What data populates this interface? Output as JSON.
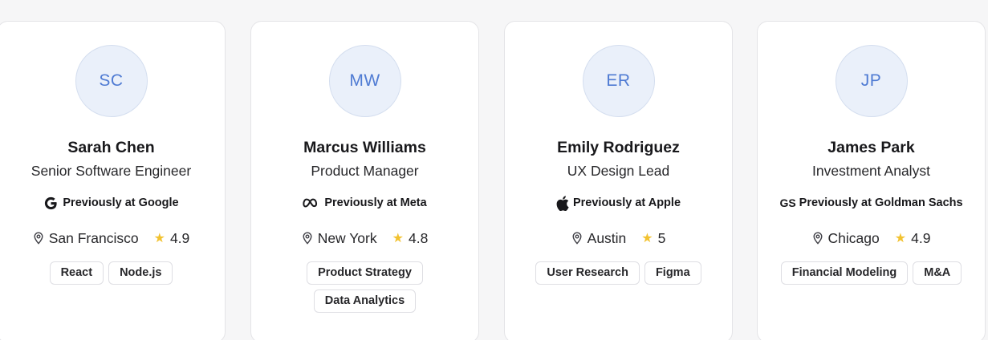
{
  "people": [
    {
      "initials": "SC",
      "name": "Sarah Chen",
      "role": "Senior Software Engineer",
      "company_logo": "google-g-icon",
      "previous": "Previously at Google",
      "location": "San Francisco",
      "rating": "4.9",
      "skills": [
        "React",
        "Node.js"
      ]
    },
    {
      "initials": "MW",
      "name": "Marcus Williams",
      "role": "Product Manager",
      "company_logo": "meta-infinity-icon",
      "previous": "Previously at Meta",
      "location": "New York",
      "rating": "4.8",
      "skills": [
        "Product Strategy",
        "Data Analytics"
      ]
    },
    {
      "initials": "ER",
      "name": "Emily Rodriguez",
      "role": "UX Design Lead",
      "company_logo": "apple-icon",
      "previous": "Previously at Apple",
      "location": "Austin",
      "rating": "5",
      "skills": [
        "User Research",
        "Figma"
      ]
    },
    {
      "initials": "JP",
      "name": "James Park",
      "role": "Investment Analyst",
      "company_logo_text": "GS",
      "previous": "Previously at Goldman Sachs",
      "location": "Chicago",
      "rating": "4.9",
      "skills": [
        "Financial Modeling",
        "M&A"
      ]
    }
  ],
  "colors": {
    "avatar_bg": "#eaf0fa",
    "avatar_text": "#4f7bd3",
    "star": "#f2c230"
  }
}
